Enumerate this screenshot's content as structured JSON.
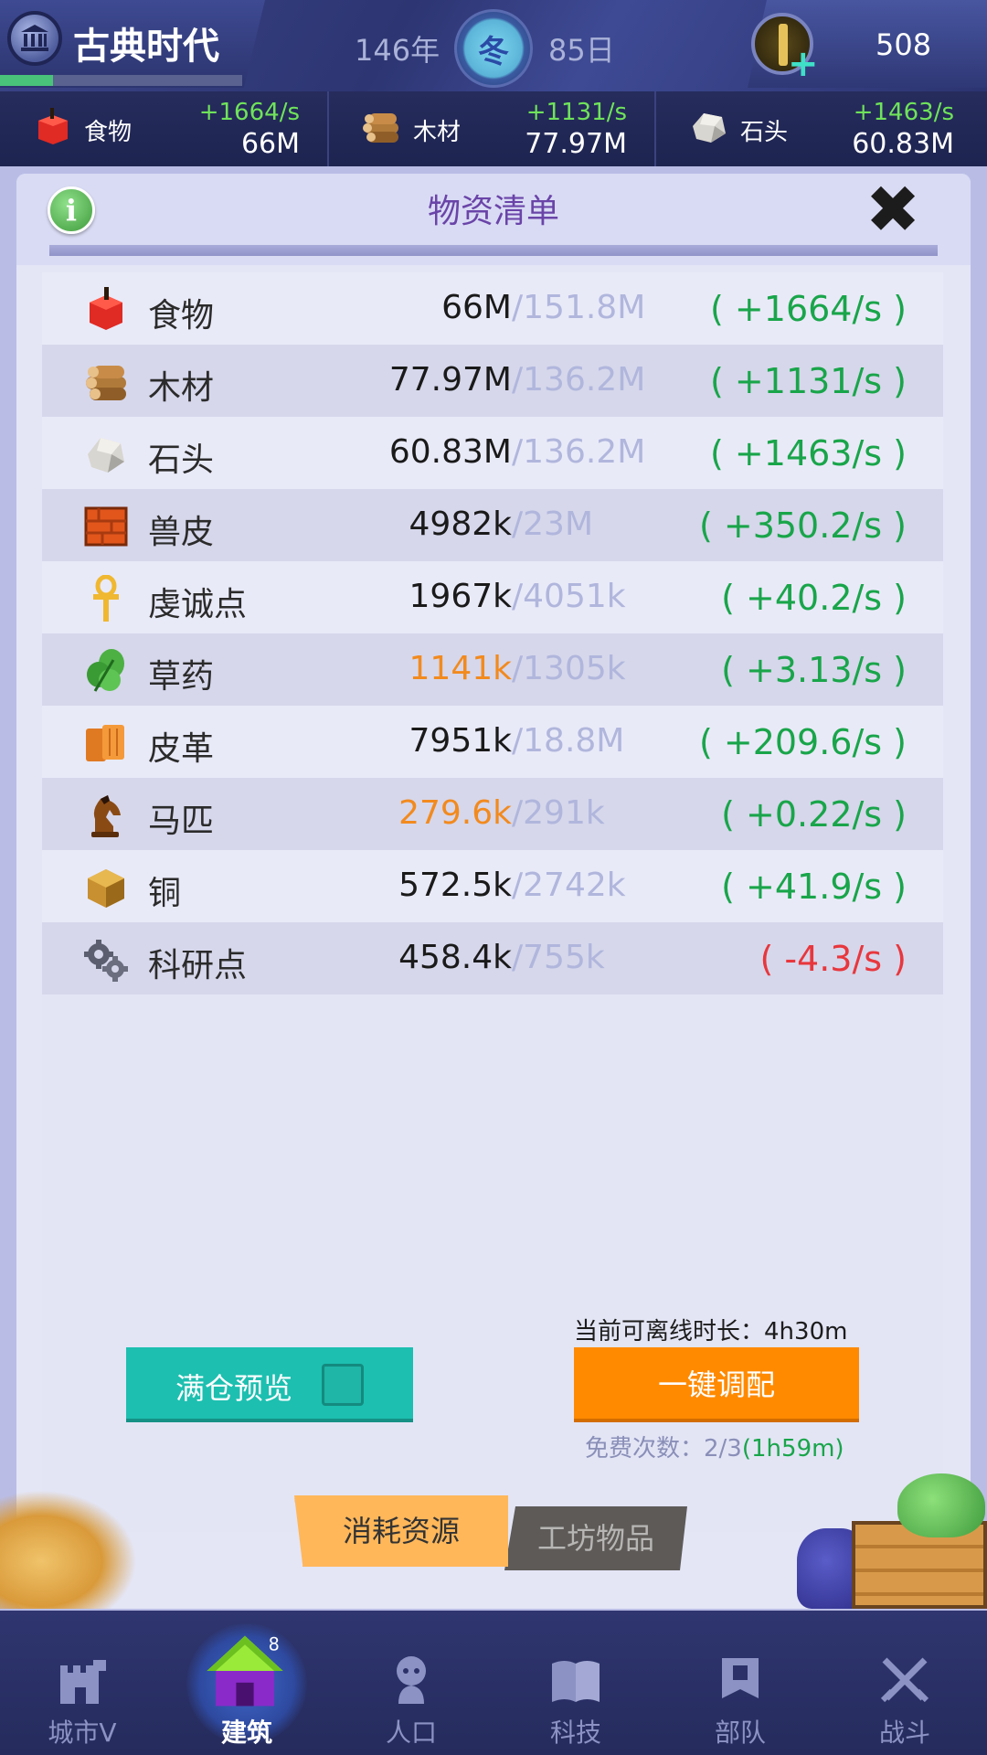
{
  "header": {
    "era_title": "古典时代",
    "era_progress": 0.22,
    "year": "146年",
    "season": "冬",
    "day": "85日",
    "gems": "508"
  },
  "resource_strip": [
    {
      "icon": "food-icon",
      "name": "食物",
      "rate": "+1664/s",
      "amount": "66M"
    },
    {
      "icon": "wood-icon",
      "name": "木材",
      "rate": "+1131/s",
      "amount": "77.97M"
    },
    {
      "icon": "stone-icon",
      "name": "石头",
      "rate": "+1463/s",
      "amount": "60.83M"
    }
  ],
  "panel": {
    "title": "物资清单",
    "info_glyph": "i",
    "close_glyph": "✖"
  },
  "resources": [
    {
      "icon": "food-icon",
      "name": "食物",
      "qty": "66M",
      "cap": "/151.8M",
      "rate": "( +1664/s )",
      "qty_warn": false,
      "rate_neg": false
    },
    {
      "icon": "wood-icon",
      "name": "木材",
      "qty": "77.97M",
      "cap": "/136.2M",
      "rate": "( +1131/s )",
      "qty_warn": false,
      "rate_neg": false
    },
    {
      "icon": "stone-icon",
      "name": "石头",
      "qty": "60.83M",
      "cap": "/136.2M",
      "rate": "( +1463/s )",
      "qty_warn": false,
      "rate_neg": false
    },
    {
      "icon": "hide-icon",
      "name": "兽皮",
      "qty": "4982k",
      "cap": "/23M",
      "rate": "( +350.2/s )",
      "qty_warn": false,
      "rate_neg": false
    },
    {
      "icon": "ankh-icon",
      "name": "虔诚点",
      "qty": "1967k",
      "cap": "/4051k",
      "rate": "( +40.2/s )",
      "qty_warn": false,
      "rate_neg": false
    },
    {
      "icon": "herb-icon",
      "name": "草药",
      "qty": "1141k",
      "cap": "/1305k",
      "rate": "( +3.13/s )",
      "qty_warn": true,
      "rate_neg": false
    },
    {
      "icon": "leather-icon",
      "name": "皮革",
      "qty": "7951k",
      "cap": "/18.8M",
      "rate": "( +209.6/s )",
      "qty_warn": false,
      "rate_neg": false
    },
    {
      "icon": "horse-icon",
      "name": "马匹",
      "qty": "279.6k",
      "cap": "/291k",
      "rate": "( +0.22/s )",
      "qty_warn": true,
      "rate_neg": false
    },
    {
      "icon": "copper-icon",
      "name": "铜",
      "qty": "572.5k",
      "cap": "/2742k",
      "rate": "( +41.9/s )",
      "qty_warn": false,
      "rate_neg": false
    },
    {
      "icon": "gears-icon",
      "name": "科研点",
      "qty": "458.4k",
      "cap": "/755k",
      "rate": "( -4.3/s )",
      "qty_warn": false,
      "rate_neg": true
    }
  ],
  "footer": {
    "offline_label": "当前可离线时长：4h30m",
    "preview_label": "满仓预览",
    "dispatch_label": "一键调配",
    "free_times_prefix": "免费次数：2/3",
    "free_times_cooldown": "(1h59m)",
    "tab_consume": "消耗资源",
    "tab_workshop": "工坊物品"
  },
  "nav": [
    {
      "icon": "castle-icon",
      "label": "城市V",
      "active": false
    },
    {
      "icon": "house-icon",
      "label": "建筑",
      "active": true
    },
    {
      "icon": "person-icon",
      "label": "人口",
      "active": false
    },
    {
      "icon": "book-icon",
      "label": "科技",
      "active": false
    },
    {
      "icon": "banner-icon",
      "label": "部队",
      "active": false
    },
    {
      "icon": "swords-icon",
      "label": "战斗",
      "active": false
    }
  ],
  "colors": {
    "accent_green": "#19a54a",
    "warn_orange": "#f28a1e",
    "negative_red": "#e8373d",
    "teal_button": "#1dbfb0",
    "orange_button": "#ff8a00",
    "title_purple": "#6a44a8"
  }
}
